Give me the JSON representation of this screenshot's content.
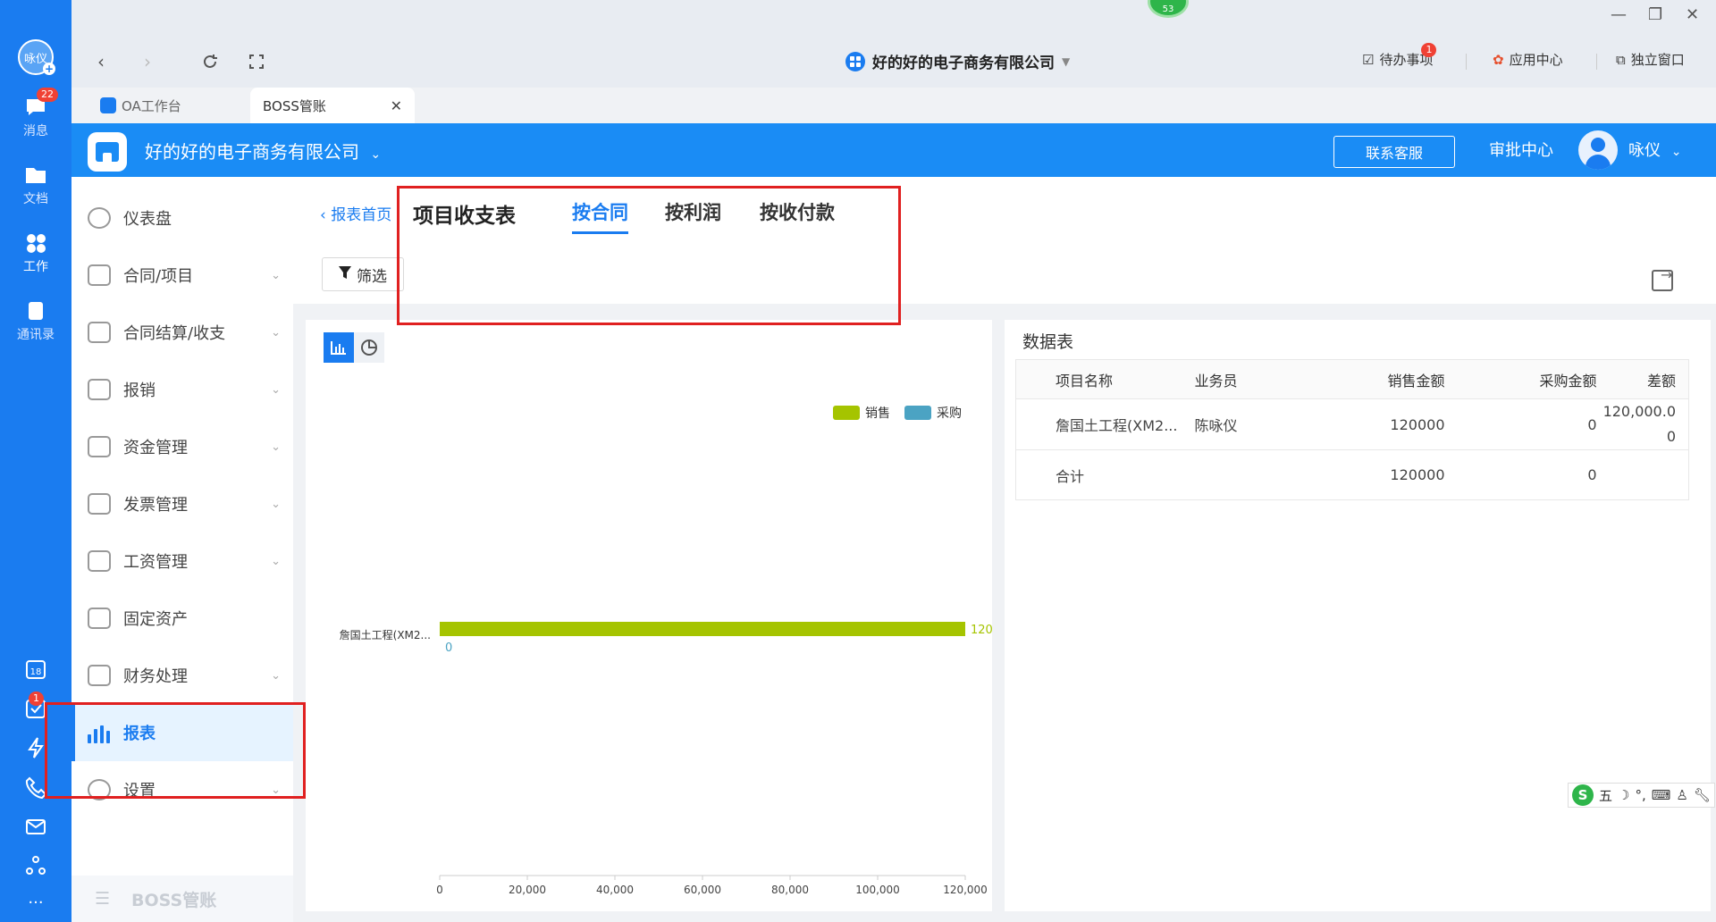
{
  "rail": {
    "avatar_text": "咏仪",
    "items": [
      {
        "label": "消息",
        "badge": "22"
      },
      {
        "label": "文档"
      },
      {
        "label": "工作"
      },
      {
        "label": "通讯录"
      }
    ],
    "calendar_day": "18",
    "task_badge": "1"
  },
  "titlebar": {
    "company": "好的好的电子商务有限公司",
    "badge_green": "53",
    "todo_label": "待办事项",
    "todo_badge": "1",
    "app_center_label": "应用中心",
    "standalone_label": "独立窗口"
  },
  "tabs": [
    {
      "label": "OA工作台"
    },
    {
      "label": "BOSS管账"
    }
  ],
  "appbar": {
    "company": "好的好的电子商务有限公司",
    "contact_label": "联系客服",
    "approve_label": "审批中心",
    "user_name": "咏仪"
  },
  "sidebar": {
    "items": [
      {
        "label": "仪表盘"
      },
      {
        "label": "合同/项目"
      },
      {
        "label": "合同结算/收支"
      },
      {
        "label": "报销"
      },
      {
        "label": "资金管理"
      },
      {
        "label": "发票管理"
      },
      {
        "label": "工资管理"
      },
      {
        "label": "固定资产"
      },
      {
        "label": "财务处理"
      },
      {
        "label": "报表"
      },
      {
        "label": "设置"
      }
    ],
    "footer": "BOSS管账"
  },
  "content": {
    "back_label": "报表首页",
    "title": "项目收支表",
    "tabs": [
      "按合同",
      "按利润",
      "按收付款"
    ],
    "active_tab": 0,
    "filter_label": "筛选"
  },
  "chart_data": {
    "type": "bar",
    "orientation": "horizontal",
    "categories": [
      "詹国土工程(XM2..."
    ],
    "series": [
      {
        "name": "销售",
        "color": "#a5c400",
        "values": [
          120000
        ],
        "label": "120"
      },
      {
        "name": "采购",
        "color": "#4ba3c3",
        "values": [
          0
        ],
        "label": "0"
      }
    ],
    "xlim": [
      0,
      120000
    ],
    "xticks": [
      "0",
      "20,000",
      "40,000",
      "60,000",
      "80,000",
      "100,000",
      "120,000"
    ],
    "legend_position": "top-right"
  },
  "table": {
    "title": "数据表",
    "headers": [
      "项目名称",
      "业务员",
      "销售金额",
      "采购金额",
      "差额"
    ],
    "rows": [
      [
        "詹国土工程(XM2...",
        "陈咏仪",
        "120000",
        "0",
        "120,000.0\n0"
      ]
    ],
    "total": [
      "合计",
      "",
      "120000",
      "0",
      ""
    ]
  },
  "ime": {
    "label": "五"
  }
}
